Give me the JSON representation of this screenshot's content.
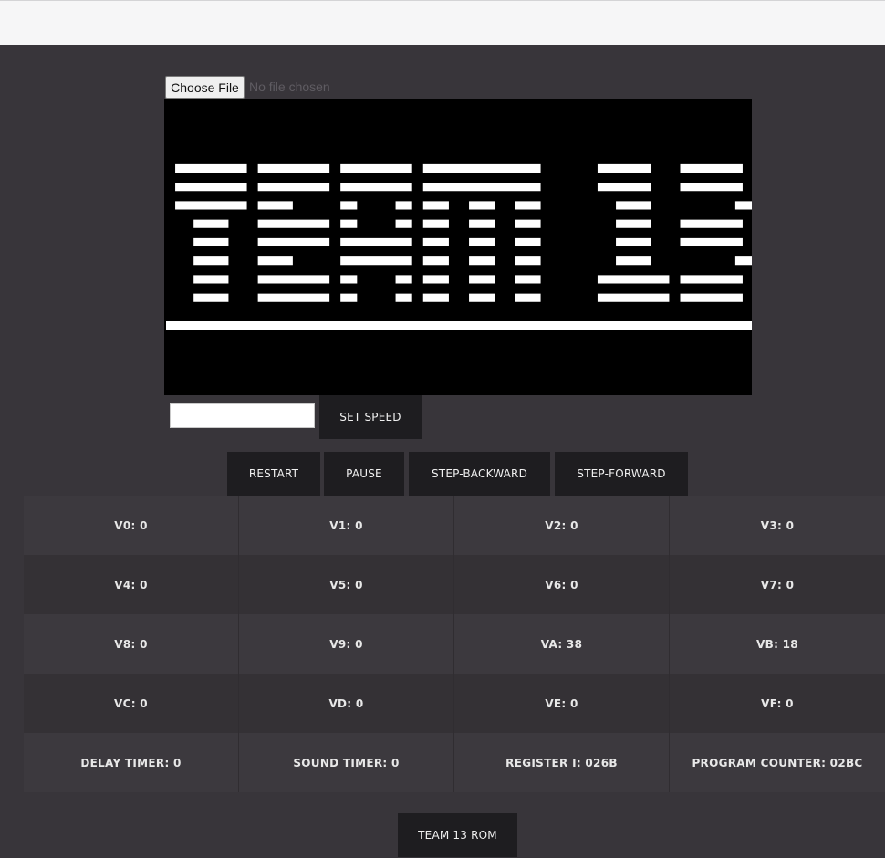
{
  "file_input": {
    "button_label": "Choose File",
    "status": "No file chosen"
  },
  "display": {
    "columns": 64,
    "rows": 32,
    "foreground": "#ffffff",
    "background": "#000000",
    "pixels": [
      "................................................................",
      "................................................................",
      "................................................................",
      "................................................................",
      "................................................................",
      "................................................................",
      "................................................................",
      ".########.########.########.#############......######...#######.",
      "................................................................",
      ".########.########.########.#############......######...#######.",
      "................................................................",
      ".########.####.....##....##.###..###..###........####.........##",
      "................................................................",
      "...####...########.##....##.###..###..###........####...#######.",
      "................................................................",
      "...####...########.########.###..###..###........####...#######.",
      "................................................................",
      "...####...####.....########.###..###..###........####.........##",
      "................................................................",
      "...####...########.##....##.###..###..###......########.#######.",
      "................................................................",
      "...####...########.##....##.###..###..###......########.#######.",
      "................................................................",
      "................................................................",
      "################################################################",
      "................................................................",
      "................................................................",
      "................................................................",
      "................................................................",
      "................................................................",
      "................................................................",
      "................................................................"
    ]
  },
  "speed": {
    "input_value": "",
    "input_placeholder": "",
    "button_label": "SET SPEED"
  },
  "controls": {
    "restart": "RESTART",
    "pause": "PAUSE",
    "step_backward": "STEP-BACKWARD",
    "step_forward": "STEP-FORWARD"
  },
  "registers": {
    "rows": [
      [
        "V0: 0",
        "V1: 0",
        "V2: 0",
        "V3: 0"
      ],
      [
        "V4: 0",
        "V5: 0",
        "V6: 0",
        "V7: 0"
      ],
      [
        "V8: 0",
        "V9: 0",
        "VA: 38",
        "VB: 18"
      ],
      [
        "VC: 0",
        "VD: 0",
        "VE: 0",
        "VF: 0"
      ],
      [
        "DELAY TIMER: 0",
        "SOUND TIMER: 0",
        "REGISTER I: 026B",
        "PROGRAM COUNTER: 02BC"
      ]
    ]
  },
  "rom_button": "TEAM 13 ROM"
}
